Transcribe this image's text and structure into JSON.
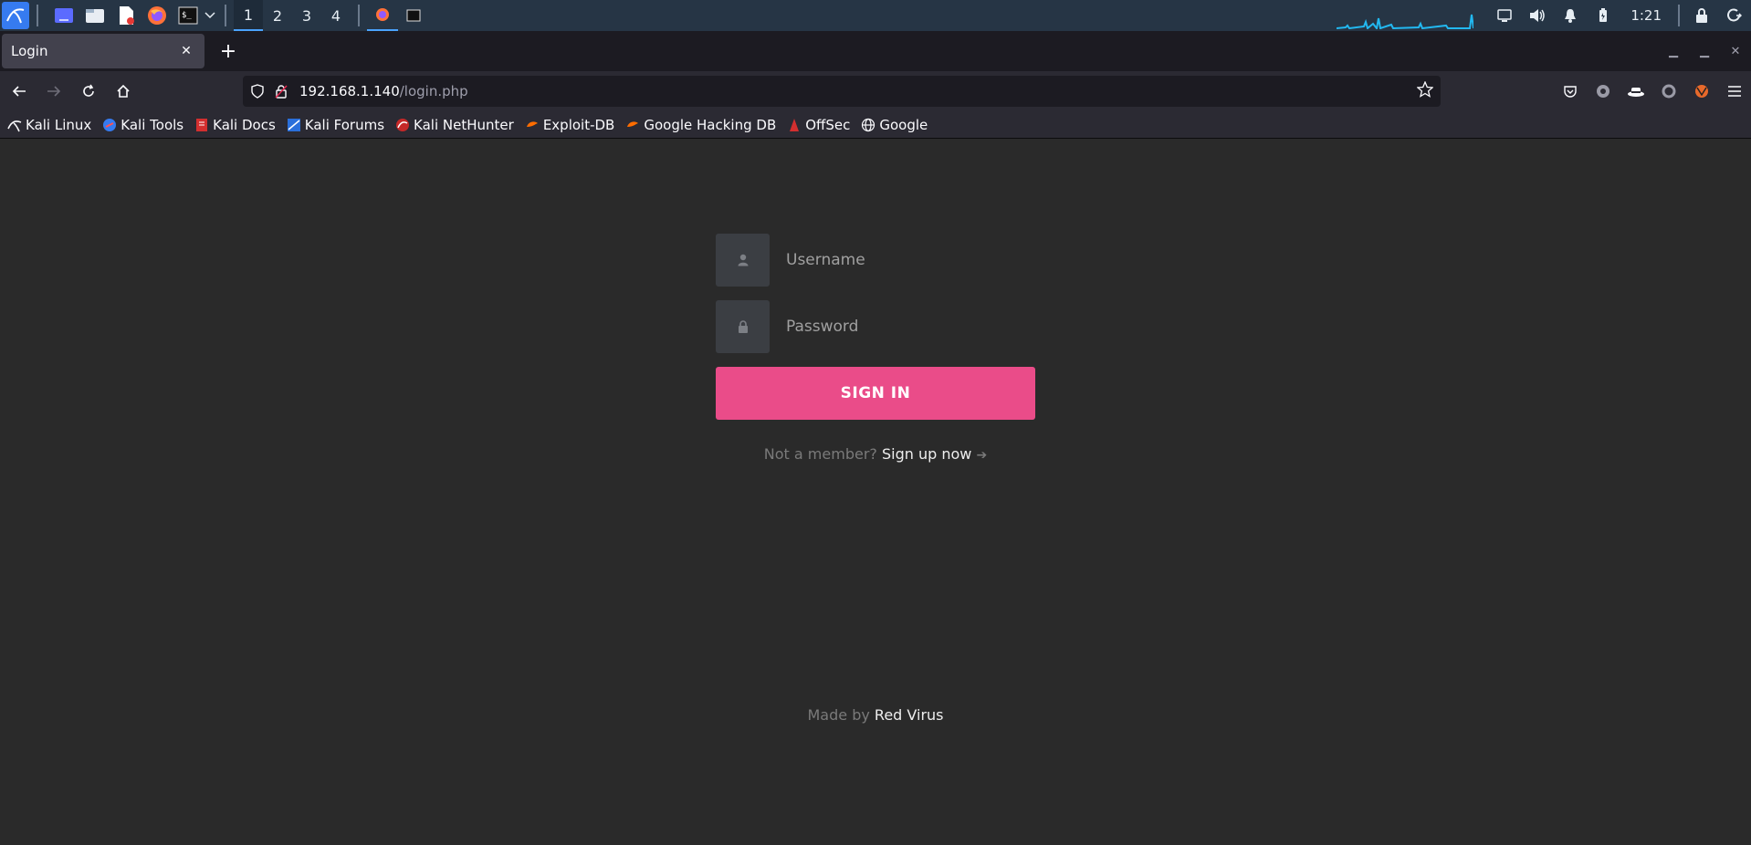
{
  "taskbar": {
    "workspaces": [
      "1",
      "2",
      "3",
      "4"
    ],
    "active_workspace": "1",
    "clock": "1:21",
    "accent_color": "#4aa3ff"
  },
  "browser": {
    "tab_title": "Login",
    "url_host": "192.168.1.140",
    "url_path": "/login.php",
    "bookmarks": [
      {
        "label": "Kali Linux",
        "icon": "kali-icon"
      },
      {
        "label": "Kali Tools",
        "icon": "kali-tools-icon"
      },
      {
        "label": "Kali Docs",
        "icon": "kali-docs-icon"
      },
      {
        "label": "Kali Forums",
        "icon": "kali-forums-icon"
      },
      {
        "label": "Kali NetHunter",
        "icon": "nethunter-icon"
      },
      {
        "label": "Exploit-DB",
        "icon": "exploit-db-icon"
      },
      {
        "label": "Google Hacking DB",
        "icon": "ghdb-icon"
      },
      {
        "label": "OffSec",
        "icon": "offsec-icon"
      },
      {
        "label": "Google",
        "icon": "globe-icon"
      }
    ]
  },
  "login": {
    "username_placeholder": "Username",
    "password_placeholder": "Password",
    "signin_label": "SIGN IN",
    "not_member_text": "Not a member?",
    "signup_link": "Sign up now",
    "signup_arrow": "➔",
    "button_color": "#ea4c89"
  },
  "footer": {
    "made_by_text": "Made by",
    "author": "Red Virus"
  }
}
